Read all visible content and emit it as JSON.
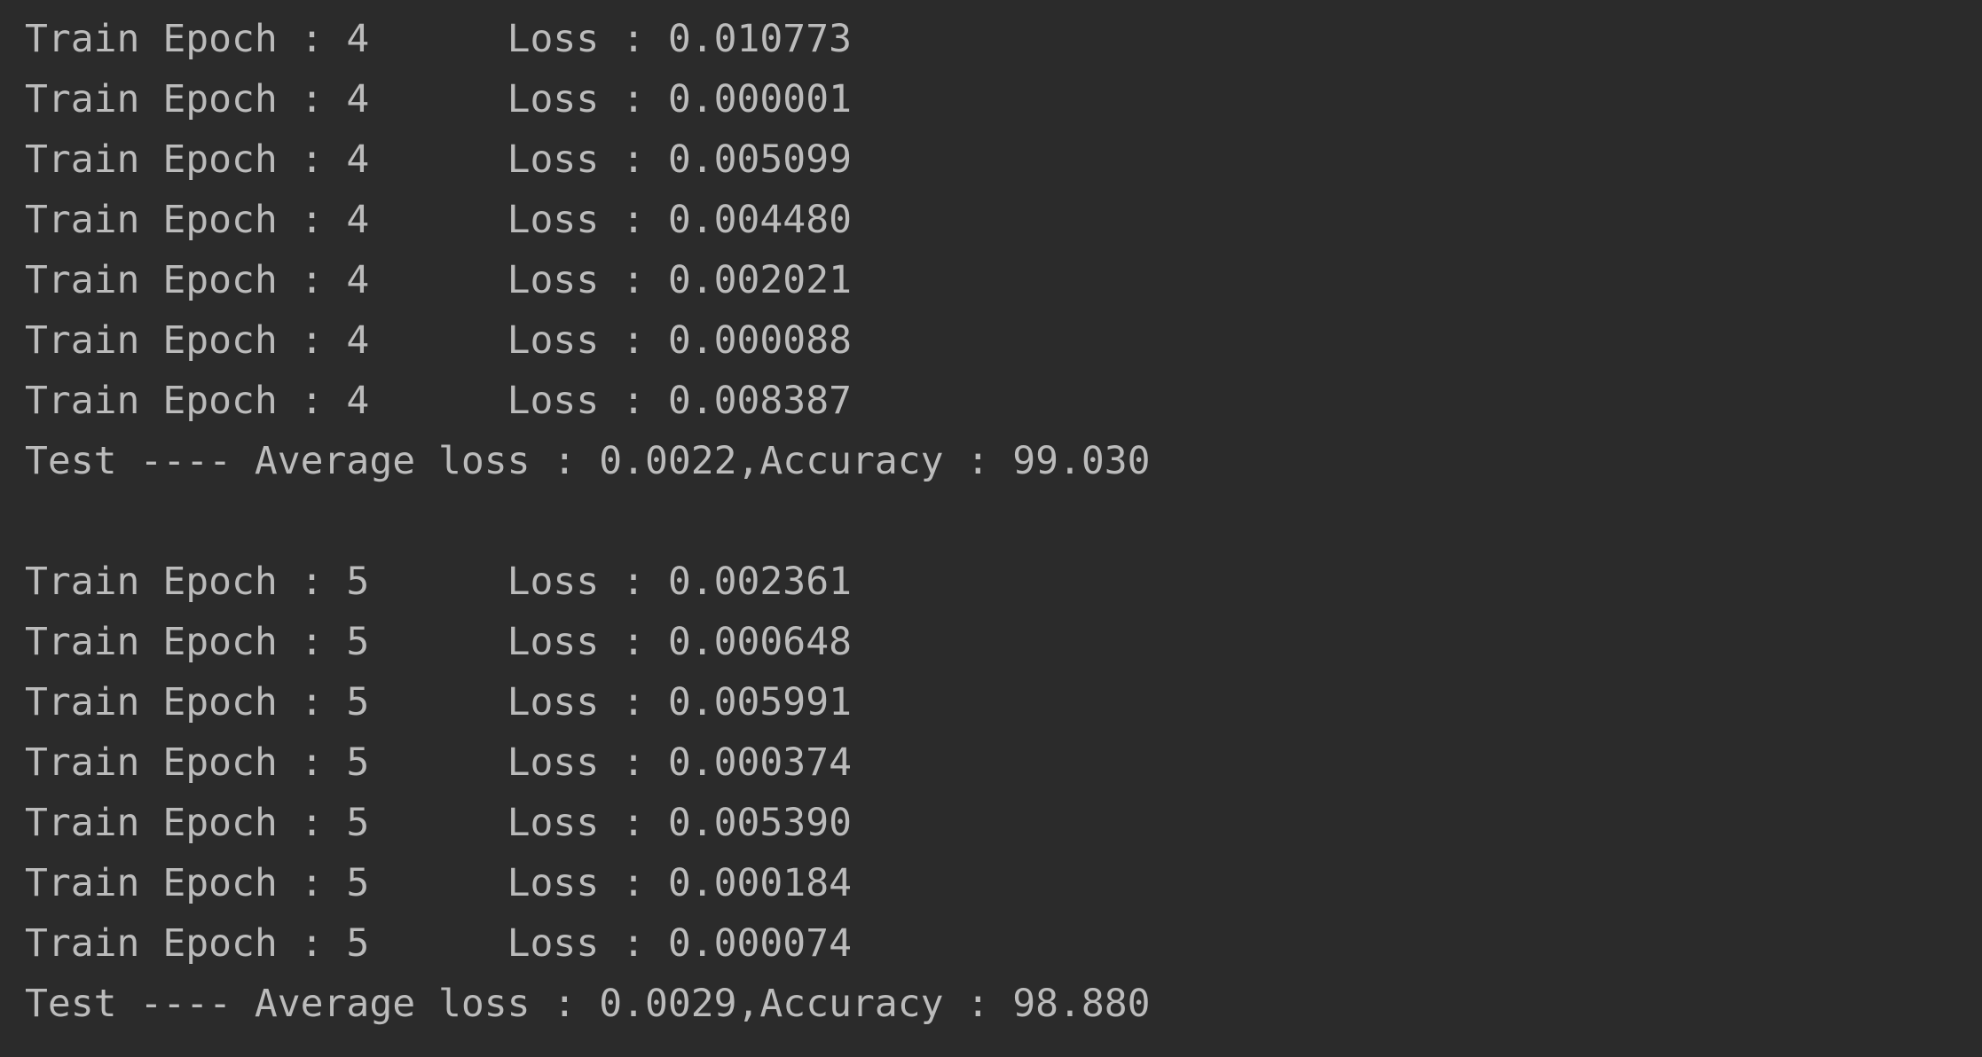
{
  "console": {
    "lines": [
      "Train Epoch : 4      Loss : 0.010773",
      "Train Epoch : 4      Loss : 0.000001",
      "Train Epoch : 4      Loss : 0.005099",
      "Train Epoch : 4      Loss : 0.004480",
      "Train Epoch : 4      Loss : 0.002021",
      "Train Epoch : 4      Loss : 0.000088",
      "Train Epoch : 4      Loss : 0.008387",
      "Test ---- Average loss : 0.0022,Accuracy : 99.030",
      "",
      "Train Epoch : 5      Loss : 0.002361",
      "Train Epoch : 5      Loss : 0.000648",
      "Train Epoch : 5      Loss : 0.005991",
      "Train Epoch : 5      Loss : 0.000374",
      "Train Epoch : 5      Loss : 0.005390",
      "Train Epoch : 5      Loss : 0.000184",
      "Train Epoch : 5      Loss : 0.000074",
      "Test ---- Average loss : 0.0029,Accuracy : 98.880"
    ]
  },
  "colors": {
    "background": "#2b2b2b",
    "text": "#bbbbbb"
  }
}
